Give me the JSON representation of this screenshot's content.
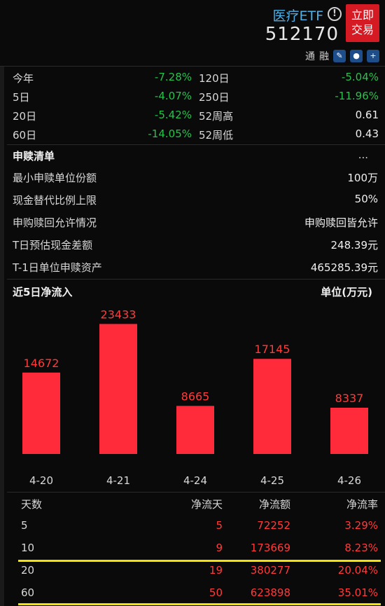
{
  "header": {
    "name": "医疗ETF",
    "code": "512170",
    "trade_button": [
      "立即",
      "交易"
    ],
    "tools": [
      "通",
      "融"
    ],
    "tool_icons": [
      "pencil-icon",
      "bell-icon",
      "plus-icon"
    ]
  },
  "returns": [
    {
      "l_label": "今年",
      "l_value": "-7.28%",
      "r_label": "120日",
      "r_value": "-5.04%"
    },
    {
      "l_label": "5日",
      "l_value": "-4.07%",
      "r_label": "250日",
      "r_value": "-11.96%"
    },
    {
      "l_label": "20日",
      "l_value": "-5.42%",
      "r_label": "52周高",
      "r_value": "0.61"
    },
    {
      "l_label": "60日",
      "l_value": "-14.05%",
      "r_label": "52周低",
      "r_value": "0.43"
    }
  ],
  "subscribe": {
    "title": "申赎清单",
    "more": "...",
    "rows": [
      {
        "label": "最小申赎单位份额",
        "value": "100万"
      },
      {
        "label": "现金替代比例上限",
        "value": "50%"
      },
      {
        "label": "申购赎回允许情况",
        "value": "申购赎回皆允许"
      },
      {
        "label": "T日预估现金差额",
        "value": "248.39元"
      },
      {
        "label": "T-1日单位申赎资产",
        "value": "465285.39元"
      }
    ]
  },
  "inflow": {
    "title": "近5日净流入",
    "unit": "单位(万元)"
  },
  "chart_data": {
    "type": "bar",
    "categories": [
      "4-20",
      "4-21",
      "4-24",
      "4-25",
      "4-26"
    ],
    "values": [
      14672,
      23433,
      8665,
      17145,
      8337
    ],
    "ylim": [
      0,
      25000
    ],
    "bar_color": "#ff2a3a",
    "label_color": "#ff3b3b"
  },
  "flow_table": {
    "headers": [
      "天数",
      "净流天",
      "净流额",
      "净流率"
    ],
    "rows": [
      [
        "5",
        "5",
        "72252",
        "3.29%"
      ],
      [
        "10",
        "9",
        "173669",
        "8.23%"
      ],
      [
        "20",
        "19",
        "380277",
        "20.04%"
      ],
      [
        "60",
        "50",
        "623898",
        "35.01%"
      ]
    ]
  },
  "colors": {
    "accent_blue": "#4bb0e8",
    "trade_red": "#d51a24",
    "negative_green": "#27c24c",
    "positive_red": "#ff3b3b",
    "highlight_yellow": "#f4e200"
  }
}
